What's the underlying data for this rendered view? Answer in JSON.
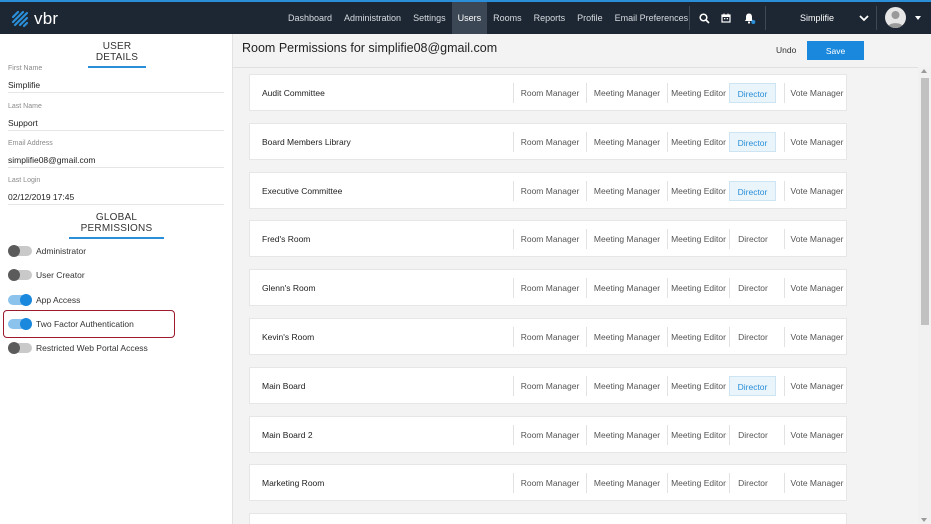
{
  "brand": {
    "logo_text": "vbr",
    "accent": "#2a8fd8",
    "nav_bg": "#1d2733"
  },
  "nav": {
    "items": [
      {
        "label": "Dashboard",
        "active": false
      },
      {
        "label": "Administration",
        "active": false
      },
      {
        "label": "Settings",
        "active": false
      },
      {
        "label": "Users",
        "active": true
      },
      {
        "label": "Rooms",
        "active": false
      },
      {
        "label": "Reports",
        "active": false
      },
      {
        "label": "Profile",
        "active": false
      },
      {
        "label": "Email Preferences",
        "active": false
      }
    ],
    "icons": [
      "search-icon",
      "calendar-icon",
      "bell-icon"
    ],
    "user_name": "Simplifie"
  },
  "sidebar": {
    "user_details_title": "USER DETAILS",
    "fields": [
      {
        "label": "First Name",
        "value": "Simplifie"
      },
      {
        "label": "Last Name",
        "value": "Support"
      },
      {
        "label": "Email Address",
        "value": "simplifie08@gmail.com"
      },
      {
        "label": "Last Login",
        "value": "02/12/2019 17:45"
      }
    ],
    "global_permissions_title": "GLOBAL PERMISSIONS",
    "permissions": [
      {
        "label": "Administrator",
        "on": false
      },
      {
        "label": "User Creator",
        "on": false
      },
      {
        "label": "App Access",
        "on": true
      },
      {
        "label": "Two Factor Authentication",
        "on": true
      },
      {
        "label": "Restricted Web Portal Access",
        "on": false
      }
    ]
  },
  "main": {
    "title": "Room Permissions for simplifie08@gmail.com",
    "undo_label": "Undo",
    "save_label": "Save",
    "roles": [
      "Room Manager",
      "Meeting Manager",
      "Meeting Editor",
      "Director",
      "Vote Manager"
    ],
    "rooms": [
      {
        "name": "Audit Committee",
        "selected_role": "Director"
      },
      {
        "name": "Board Members Library",
        "selected_role": "Director"
      },
      {
        "name": "Executive Committee",
        "selected_role": "Director"
      },
      {
        "name": "Fred's Room",
        "selected_role": ""
      },
      {
        "name": "Glenn's Room",
        "selected_role": ""
      },
      {
        "name": "Kevin's Room",
        "selected_role": ""
      },
      {
        "name": "Main Board",
        "selected_role": "Director"
      },
      {
        "name": "Main Board 2",
        "selected_role": ""
      },
      {
        "name": "Marketing Room",
        "selected_role": ""
      }
    ]
  }
}
